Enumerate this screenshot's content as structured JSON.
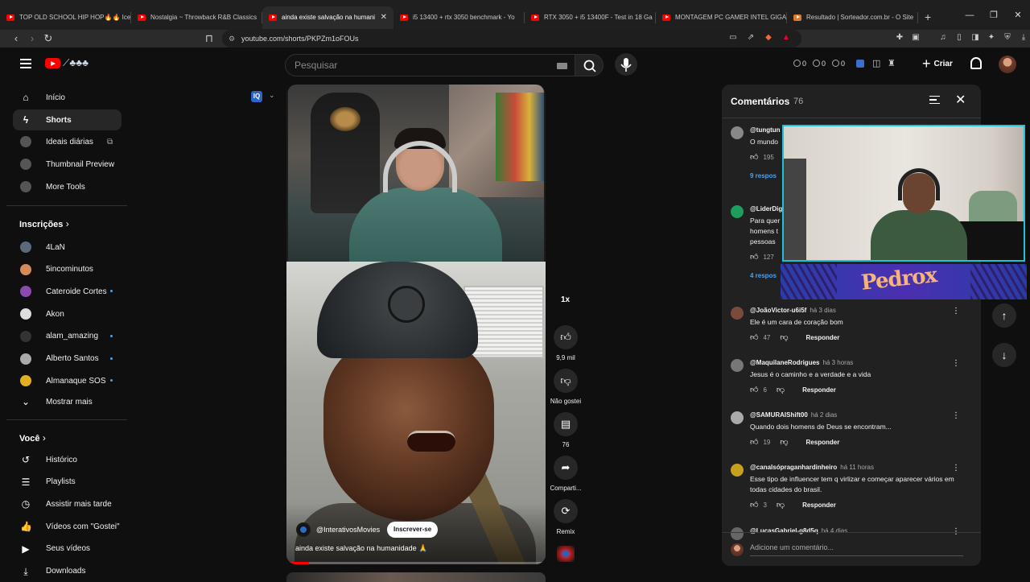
{
  "browser": {
    "tabs": [
      {
        "title": "TOP OLD SCHOOL HIP HOP🔥🔥 Ice",
        "active": false
      },
      {
        "title": "Nostalgia ~ Throwback R&B Classics",
        "active": false
      },
      {
        "title": "ainda existe salvação na humani",
        "active": true
      },
      {
        "title": "i5 13400 + rtx 3050 benchmark - Yo",
        "active": false
      },
      {
        "title": "RTX 3050 + i5 13400F - Test in 18 Ga",
        "active": false
      },
      {
        "title": "MONTAGEM PC GAMER INTEL GIGA",
        "active": false
      },
      {
        "title": "Resultado | Sorteador.com.br - O Site",
        "active": false
      }
    ],
    "new_tab": "+",
    "url": "youtube.com/shorts/PKPZm1oFOUs"
  },
  "header": {
    "search_placeholder": "Pesquisar",
    "counters": [
      "0",
      "0",
      "0"
    ],
    "create_label": "Criar"
  },
  "sidebar": {
    "main": [
      {
        "label": "Início",
        "icon": "⌂"
      },
      {
        "label": "Shorts",
        "icon": "S"
      },
      {
        "label": "Ideais diárias",
        "icon": "◉"
      },
      {
        "label": "Thumbnail Preview",
        "icon": "◉"
      },
      {
        "label": "More Tools",
        "icon": "◉"
      }
    ],
    "subs_title": "Inscrições",
    "subs": [
      {
        "label": "4LaN",
        "color": "#5a6a7a"
      },
      {
        "label": "5incominutos",
        "color": "#d98a5a"
      },
      {
        "label": "Cateroide Cortes",
        "color": "#8a4ab0"
      },
      {
        "label": "Akon",
        "color": "#ddd"
      },
      {
        "label": "alam_amazing",
        "color": "#333"
      },
      {
        "label": "Alberto Santos",
        "color": "#aaa"
      },
      {
        "label": "Almanaque SOS",
        "color": "#e0b020"
      }
    ],
    "show_more": "Mostrar mais",
    "you_title": "Você",
    "you": [
      {
        "label": "Histórico",
        "icon": "↺"
      },
      {
        "label": "Playlists",
        "icon": "☰"
      },
      {
        "label": "Assistir mais tarde",
        "icon": "◷"
      },
      {
        "label": "Vídeos com \"Gostei\"",
        "icon": "👍"
      },
      {
        "label": "Seus vídeos",
        "icon": "▶"
      },
      {
        "label": "Downloads",
        "icon": "⤓"
      }
    ]
  },
  "short": {
    "channel": "@InterativosMovies",
    "subscribe": "Inscrever-se",
    "title": "ainda existe salvação na humanidade 🙏",
    "speed": "1x",
    "progress": 0.08
  },
  "actions": {
    "likes": "9,9 mil",
    "dislike": "Não gostei",
    "comments": "76",
    "share": "Comparti...",
    "remix": "Remix"
  },
  "comments_panel": {
    "title": "Comentários",
    "count": "76",
    "reply_label": "Responder",
    "input_placeholder": "Adicione um comentário...",
    "items": [
      {
        "user": "@tungtun",
        "time": "",
        "text": "O mundo",
        "likes": "195",
        "replies": "9 respos",
        "avatar": "#888"
      },
      {
        "user": "@LiderDig",
        "time": "",
        "text": "Para quer\nhomens t\npessoas",
        "likes": "127",
        "replies": "4 respos",
        "avatar": "#1e9e5e"
      },
      {
        "user": "@JoãoVictor-u6i5f",
        "time": "há 3 dias",
        "text": "Ele é um cara de coração bom",
        "likes": "47",
        "replies": "",
        "avatar": "#7a4a3a"
      },
      {
        "user": "@MaquilaneRodrigues",
        "time": "há 3 horas",
        "text": "Jesus é o caminho e a verdade e a vida",
        "likes": "6",
        "replies": "",
        "avatar": "#777"
      },
      {
        "user": "@SAMURAIShift00",
        "time": "há 2 dias",
        "text": "Quando dois homens de Deus se encontram...",
        "likes": "19",
        "replies": "",
        "avatar": "#aaa"
      },
      {
        "user": "@canalsópraganhardinheiro",
        "time": "há 11 horas",
        "text": "Esse tipo de influencer tem q virlizar e começar aparecer vários em todas cidades do brasil.",
        "likes": "3",
        "replies": "",
        "avatar": "#c8a020"
      },
      {
        "user": "@LucasGabriel-g8d5q",
        "time": "há 4 dias",
        "text": "",
        "likes": "",
        "replies": "",
        "avatar": "#666"
      }
    ]
  },
  "overlay": {
    "banner_text": "Pedrox"
  }
}
